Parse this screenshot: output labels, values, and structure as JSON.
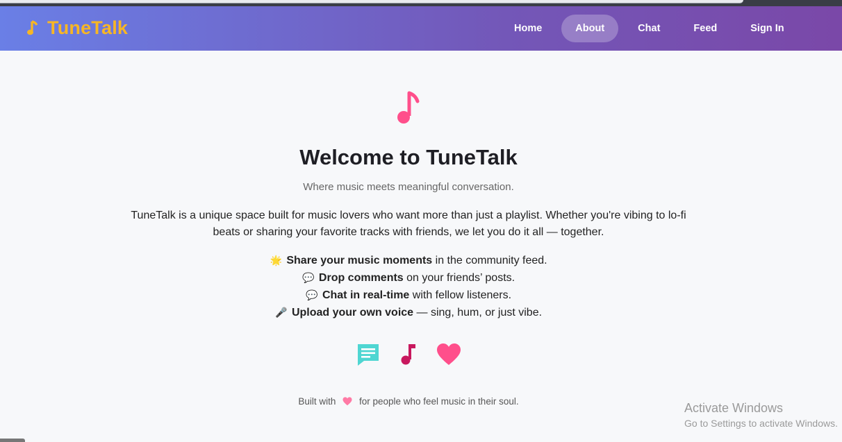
{
  "brand": {
    "name": "TuneTalk",
    "color": "#f7b625",
    "icon": "music-note-icon"
  },
  "nav": {
    "items": [
      {
        "label": "Home",
        "active": false
      },
      {
        "label": "About",
        "active": true
      },
      {
        "label": "Chat",
        "active": false
      },
      {
        "label": "Feed",
        "active": false
      },
      {
        "label": "Sign In",
        "active": false
      }
    ]
  },
  "hero": {
    "icon": "music-note-icon",
    "title": "Welcome to TuneTalk",
    "subtitle": "Where music meets meaningful conversation.",
    "description": "TuneTalk is a unique space built for music lovers who want more than just a playlist. Whether you're vibing to lo-fi beats or sharing your favorite tracks with friends, we let you do it all — together."
  },
  "features": [
    {
      "emoji": "🌟",
      "bold": "Share your music moments",
      "rest": " in the community feed."
    },
    {
      "emoji": "💬",
      "bold": "Drop comments",
      "rest": " on your friends’ posts."
    },
    {
      "emoji": "💬",
      "bold": "Chat in real-time",
      "rest": " with fellow listeners."
    },
    {
      "emoji": "🎤",
      "bold": "Upload your own voice",
      "rest": " — sing, hum, or just vibe."
    }
  ],
  "icon_row": [
    "chat-bubble-icon",
    "music-note-icon",
    "heart-icon"
  ],
  "footer": {
    "before": "Built with",
    "after": "for people who feel music in their soul."
  },
  "watermark": {
    "line1": "Activate Windows",
    "line2": "Go to Settings to activate Windows."
  },
  "colors": {
    "accent_pink": "#ff4f8b",
    "teal": "#4fd6d2",
    "crimson": "#c8185e"
  }
}
